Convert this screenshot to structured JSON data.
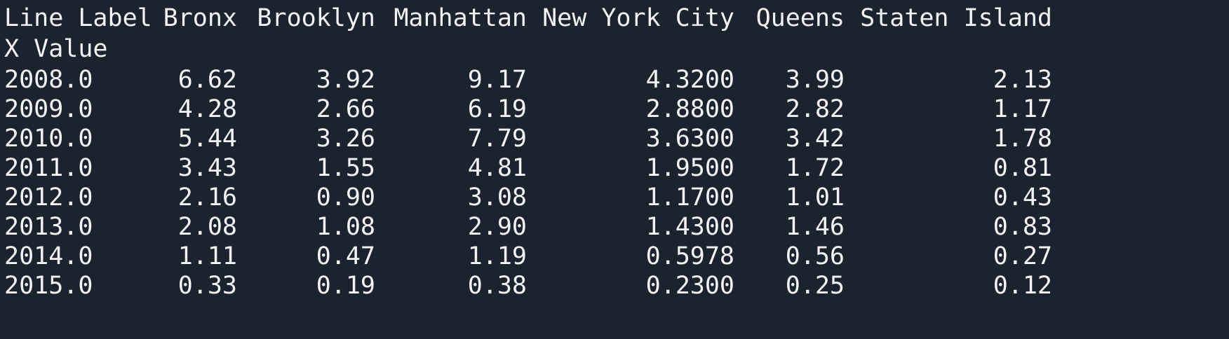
{
  "colors": {
    "background": "#1b232e",
    "text": "#f2f4f6"
  },
  "table": {
    "index_header": "Line Label",
    "index_subheader": "X Value",
    "columns": [
      "Bronx",
      "Brooklyn",
      "Manhattan",
      "New York City",
      "Queens",
      "Staten Island"
    ],
    "rows": [
      {
        "x": "2008.0",
        "values": [
          "6.62",
          "3.92",
          "9.17",
          "4.3200",
          "3.99",
          "2.13"
        ]
      },
      {
        "x": "2009.0",
        "values": [
          "4.28",
          "2.66",
          "6.19",
          "2.8800",
          "2.82",
          "1.17"
        ]
      },
      {
        "x": "2010.0",
        "values": [
          "5.44",
          "3.26",
          "7.79",
          "3.6300",
          "3.42",
          "1.78"
        ]
      },
      {
        "x": "2011.0",
        "values": [
          "3.43",
          "1.55",
          "4.81",
          "1.9500",
          "1.72",
          "0.81"
        ]
      },
      {
        "x": "2012.0",
        "values": [
          "2.16",
          "0.90",
          "3.08",
          "1.1700",
          "1.01",
          "0.43"
        ]
      },
      {
        "x": "2013.0",
        "values": [
          "2.08",
          "1.08",
          "2.90",
          "1.4300",
          "1.46",
          "0.83"
        ]
      },
      {
        "x": "2014.0",
        "values": [
          "1.11",
          "0.47",
          "1.19",
          "0.5978",
          "0.56",
          "0.27"
        ]
      },
      {
        "x": "2015.0",
        "values": [
          "0.33",
          "0.19",
          "0.38",
          "0.2300",
          "0.25",
          "0.12"
        ]
      }
    ]
  }
}
